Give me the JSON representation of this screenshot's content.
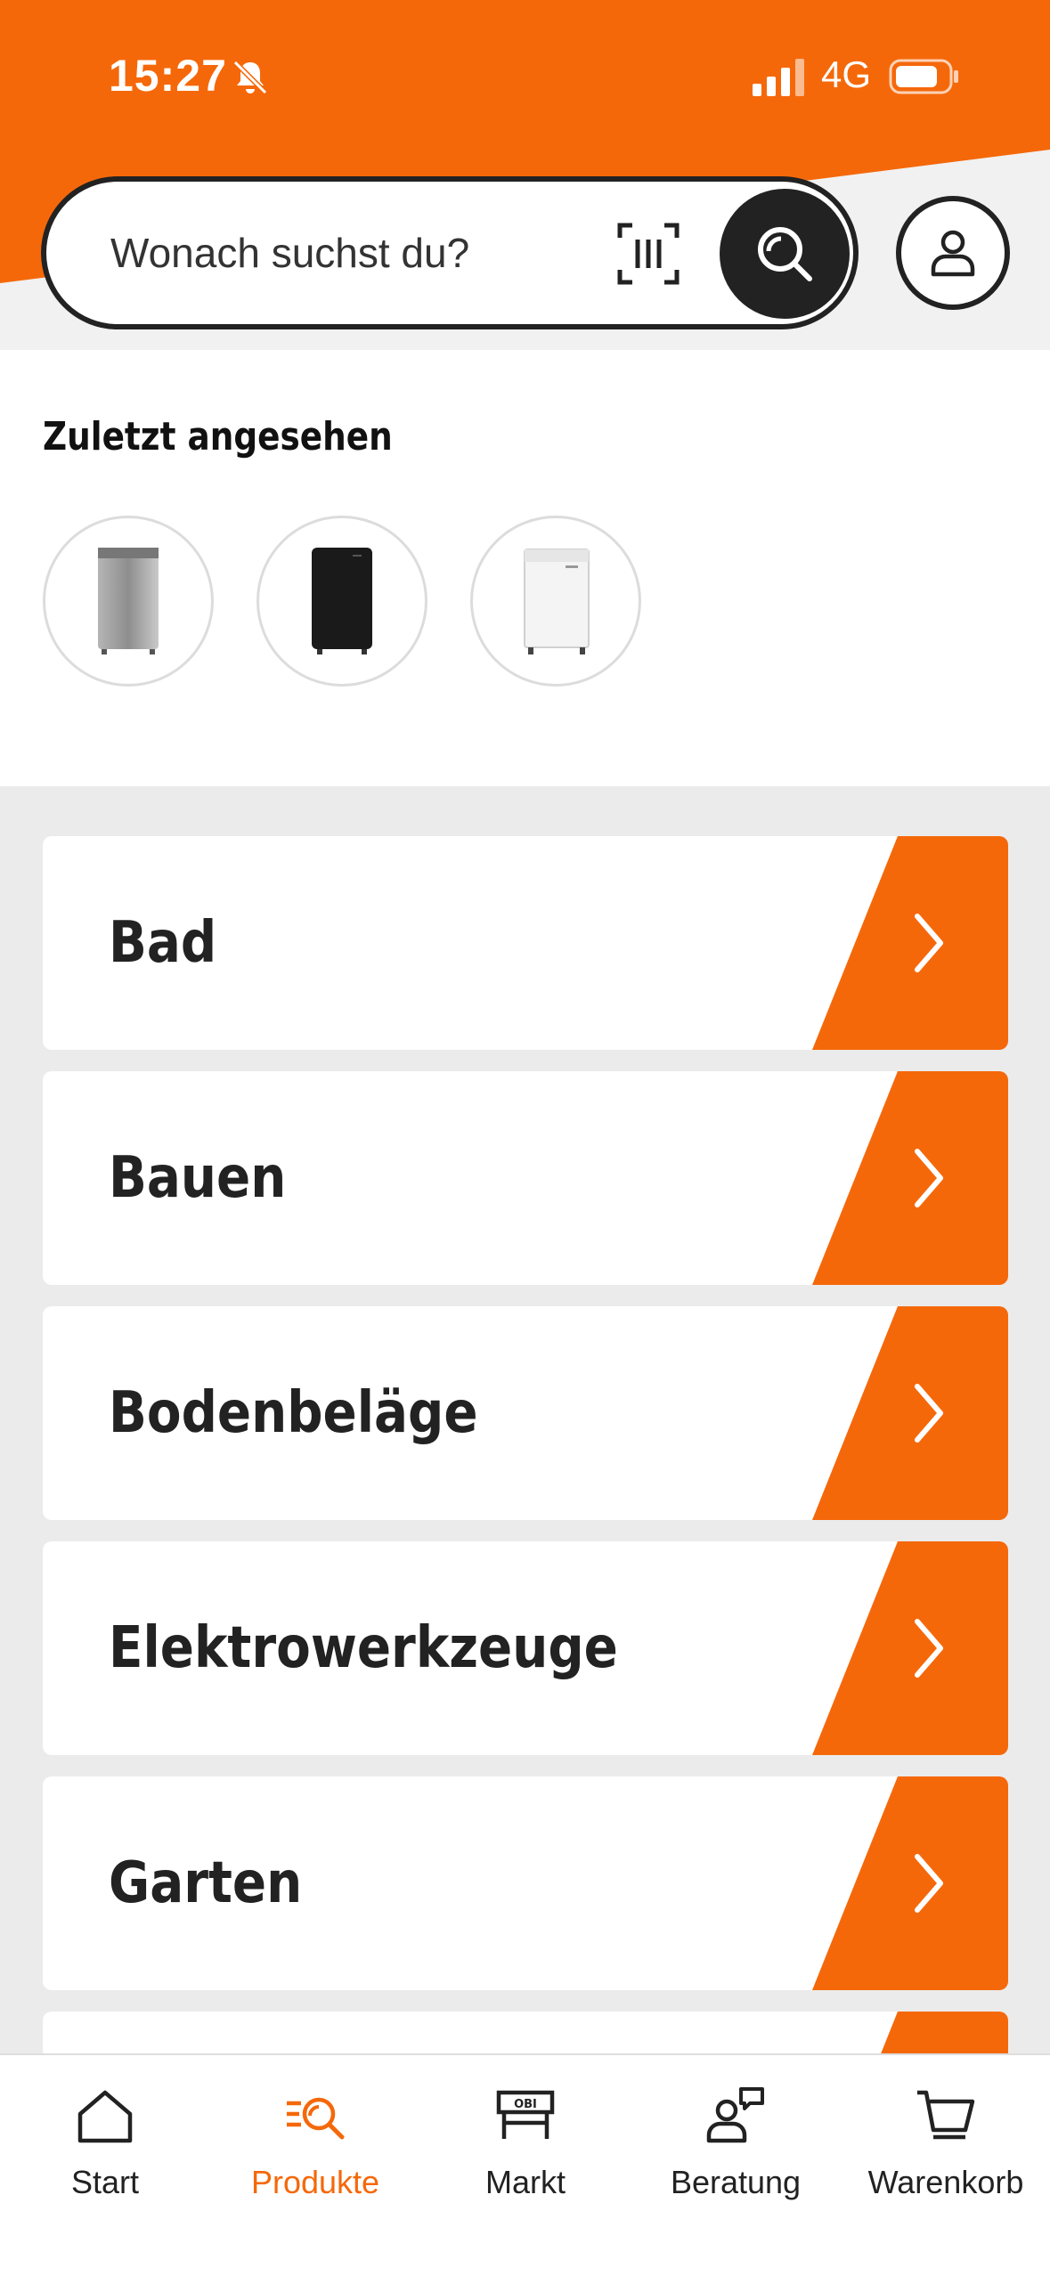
{
  "colors": {
    "accent": "#f5680a",
    "dark": "#222222",
    "background": "#ebebeb"
  },
  "status_bar": {
    "time": "15:27",
    "network": "4G",
    "icons": [
      "bell-muted-icon",
      "signal-icon",
      "battery-icon"
    ]
  },
  "search": {
    "placeholder": "Wonach suchst du?",
    "icons": [
      "barcode-scan-icon",
      "search-icon",
      "account-icon"
    ]
  },
  "recently_viewed": {
    "title": "Zuletzt angesehen",
    "items": [
      {
        "icon": "fridge-silver-icon",
        "color": "#9a9a9a"
      },
      {
        "icon": "fridge-black-icon",
        "color": "#1a1a1a"
      },
      {
        "icon": "fridge-white-icon",
        "color": "#f2f2f2"
      }
    ]
  },
  "categories": [
    {
      "label": "Bad"
    },
    {
      "label": "Bauen"
    },
    {
      "label": "Bodenbeläge"
    },
    {
      "label": "Elektrowerkzeuge"
    },
    {
      "label": "Garten"
    },
    {
      "label": ""
    }
  ],
  "bottom_nav": {
    "items": [
      {
        "label": "Start",
        "icon": "home-icon",
        "active": false
      },
      {
        "label": "Produkte",
        "icon": "products-search-icon",
        "active": true
      },
      {
        "label": "Markt",
        "icon": "store-icon",
        "active": false
      },
      {
        "label": "Beratung",
        "icon": "advice-icon",
        "active": false
      },
      {
        "label": "Warenkorb",
        "icon": "cart-icon",
        "active": false
      }
    ]
  }
}
